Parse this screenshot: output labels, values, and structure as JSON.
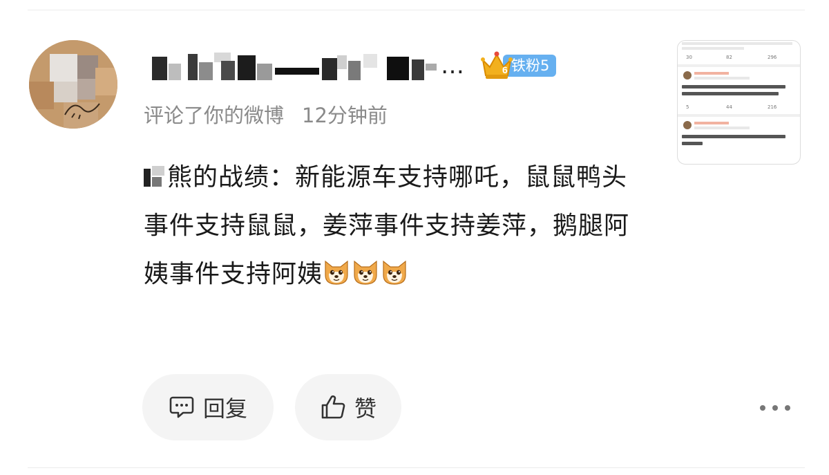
{
  "comment": {
    "action": "评论了你的微博",
    "time": "12分钟前",
    "text": "熊的战绩：新能源车支持哪吒，鼠鼠鸭头事件支持鼠鼠，姜萍事件支持姜萍，鹅腿阿姨事件支持阿姨",
    "username_suffix": "…",
    "emoji_count": 3
  },
  "fan_badge": {
    "level_number": "6",
    "label": "铁粉5",
    "color": "#66b0f0"
  },
  "thumbnail": {
    "post_stats": [
      "30",
      "82",
      "296"
    ],
    "reply1_stats": [
      "5",
      "44",
      "216"
    ]
  },
  "actions": {
    "reply_label": "回复",
    "like_label": "赞"
  },
  "icons": {
    "reply": "comment-bubble-icon",
    "like": "thumbs-up-icon",
    "more": "more-dots-icon",
    "emoji": "dog-face-emoji"
  }
}
